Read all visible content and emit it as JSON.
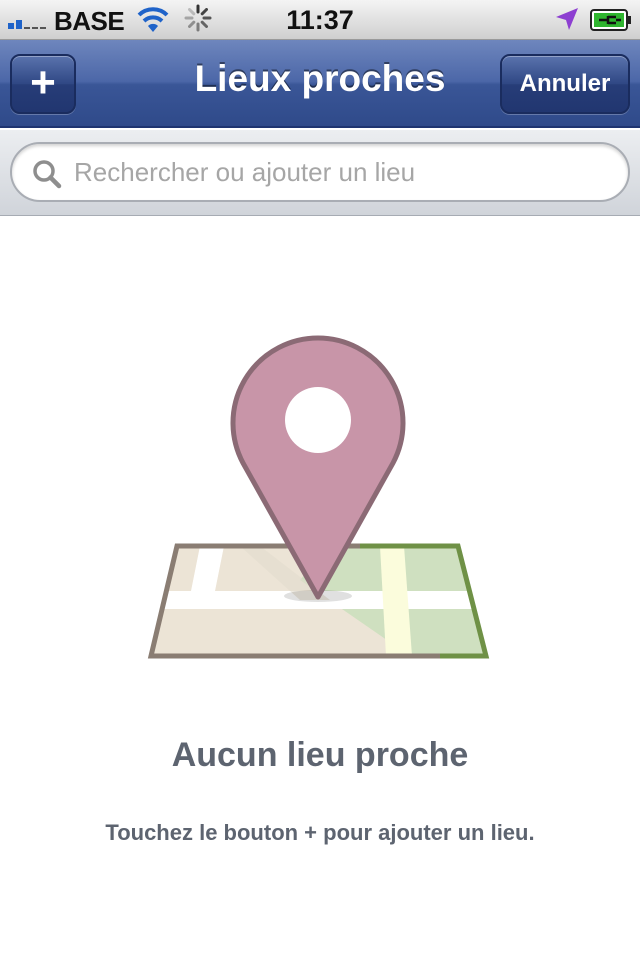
{
  "status_bar": {
    "carrier": "BASE",
    "time": "11:37",
    "icons": [
      "signal-icon",
      "wifi-icon",
      "activity-spinner-icon",
      "location-arrow-icon",
      "battery-charging-icon"
    ]
  },
  "nav": {
    "title": "Lieux proches",
    "add_label": "+",
    "cancel_label": "Annuler"
  },
  "search": {
    "placeholder": "Rechercher ou ajouter un lieu",
    "value": ""
  },
  "empty_state": {
    "icon": "map-pin-icon",
    "title": "Aucun lieu proche",
    "hint": "Touchez le bouton + pour ajouter un lieu."
  },
  "colors": {
    "nav_bar": "#3a5697",
    "pin": "#c895a8",
    "pin_outline": "#8b6a75",
    "text_muted": "#5d6470",
    "map_park": "#cfe0c0"
  }
}
